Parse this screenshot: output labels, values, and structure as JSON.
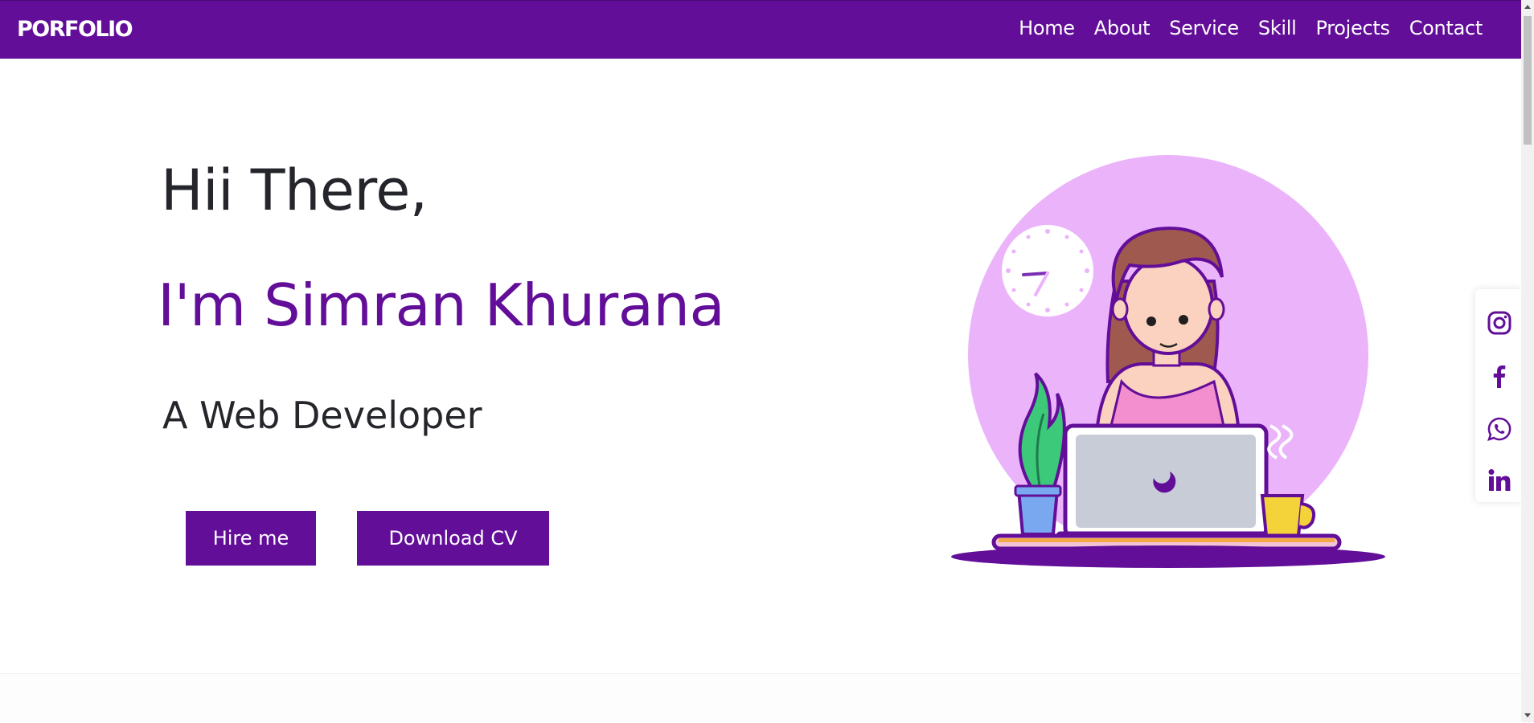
{
  "navbar": {
    "brand": "PORFOLIO",
    "links": [
      "Home",
      "About",
      "Service",
      "Skill",
      "Projects",
      "Contact"
    ]
  },
  "hero": {
    "greeting": "Hii There,",
    "name": "I'm Simran Khurana",
    "role": "A Web Developer",
    "hire_label": "Hire me",
    "cv_label": "Download CV"
  },
  "social": [
    "instagram-icon",
    "facebook-icon",
    "whatsapp-icon",
    "linkedin-icon"
  ],
  "colors": {
    "brand": "#620e99",
    "circle": "#ebb4fa",
    "text": "#24262b"
  }
}
